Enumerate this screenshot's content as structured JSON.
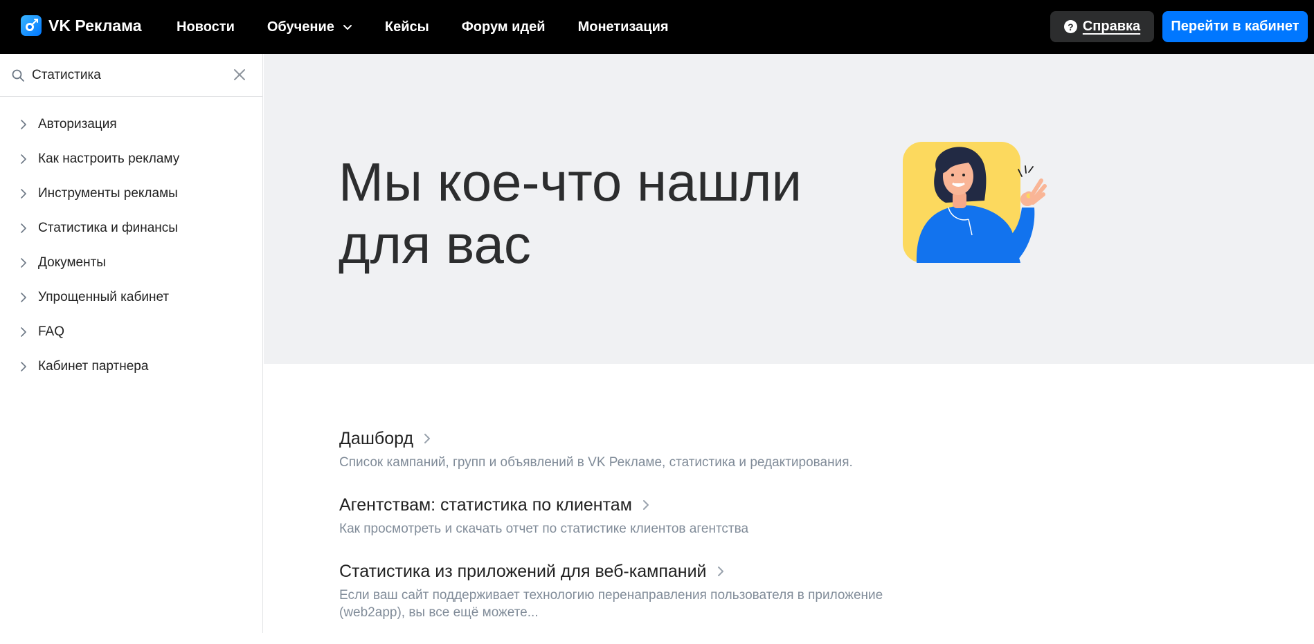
{
  "header": {
    "logo_text": "VK Реклама",
    "nav": [
      {
        "label": "Новости",
        "dropdown": false
      },
      {
        "label": "Обучение",
        "dropdown": true
      },
      {
        "label": "Кейсы",
        "dropdown": false
      },
      {
        "label": "Форум идей",
        "dropdown": false
      },
      {
        "label": "Монетизация",
        "dropdown": false
      }
    ],
    "help_label": "Справка",
    "cabinet_label": "Перейти в кабинет"
  },
  "sidebar": {
    "search_value": "Статистика",
    "items": [
      {
        "label": "Авторизация"
      },
      {
        "label": "Как настроить рекламу"
      },
      {
        "label": "Инструменты рекламы"
      },
      {
        "label": "Статистика и финансы"
      },
      {
        "label": "Документы"
      },
      {
        "label": "Упрощенный кабинет"
      },
      {
        "label": "FAQ"
      },
      {
        "label": "Кабинет партнера"
      }
    ]
  },
  "hero": {
    "title_line1": "Мы кое-что нашли",
    "title_line2": "для вас"
  },
  "results": [
    {
      "title": "Дашборд",
      "desc": "Список кампаний, групп и объявлений в VK Рекламе, статистика и редактирования."
    },
    {
      "title": "Агентствам: статистика по клиентам",
      "desc": "Как просмотреть и скачать отчет по статистике клиентов агентства"
    },
    {
      "title": "Статистика из приложений для веб-кампаний",
      "desc": "Если ваш сайт поддерживает технологию перенаправления пользователя в приложение (web2app), вы все ещё можете..."
    }
  ],
  "colors": {
    "topbar": "#000000",
    "accent": "#0077ff",
    "help_button": "#2c2d2e",
    "hero_bg": "#f0f1f3",
    "desc_text": "#818c99"
  }
}
